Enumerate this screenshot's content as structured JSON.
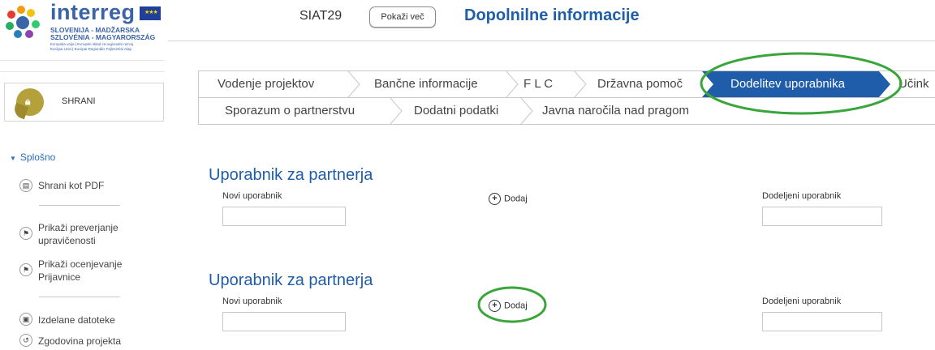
{
  "logo": {
    "brand": "interreg",
    "line1": "SLOVENIJA - MADŽARSKA",
    "line2": "SZLOVÉNIA - MAGYARORSZÁG",
    "line3": "Evropska unija | Evropski sklad za regionalni razvoj",
    "line4": "Európai Unió | Európai Regionális Fejlesztési Alap"
  },
  "sidebar": {
    "save_label": "SHRANI",
    "section_title": "Splošno",
    "items": [
      {
        "label": "Shrani kot PDF",
        "icon": "printer-icon"
      },
      {
        "label": "Prikaži preverjanje upravičenosti",
        "icon": "flag-icon"
      },
      {
        "label": "Prikaži ocenjevanje Prijavnice",
        "icon": "flag-icon"
      },
      {
        "label": "Izdelane datoteke",
        "icon": "file-icon"
      },
      {
        "label": "Zgodovina projekta",
        "icon": "history-icon"
      }
    ]
  },
  "header": {
    "code": "SIAT29",
    "show_more_button": "Pokaži več",
    "title": "Dopolnilne informacije"
  },
  "tabs": {
    "row1": [
      "Vodenje projektov",
      "Bančne informacije",
      "F L C",
      "Državna pomoč",
      "Dodelitev uporabnika",
      "Učink"
    ],
    "row2": [
      "Sporazum o partnerstvu",
      "Dodatni podatki",
      "Javna naročila nad pragom"
    ],
    "active": "Dodelitev uporabnika"
  },
  "sections": [
    {
      "heading": "Uporabnik za partnerja",
      "new_user_label": "Novi uporabnik",
      "add_label": "Dodaj",
      "assigned_label": "Dodeljeni uporabnik"
    },
    {
      "heading": "Uporabnik za partnerja",
      "new_user_label": "Novi uporabnik",
      "add_label": "Dodaj",
      "assigned_label": "Dodeljeni uporabnik"
    }
  ],
  "colors": {
    "accent_blue": "#1f5daa",
    "highlight_green": "#3aa53a",
    "save_gold": "#b5a13c"
  }
}
